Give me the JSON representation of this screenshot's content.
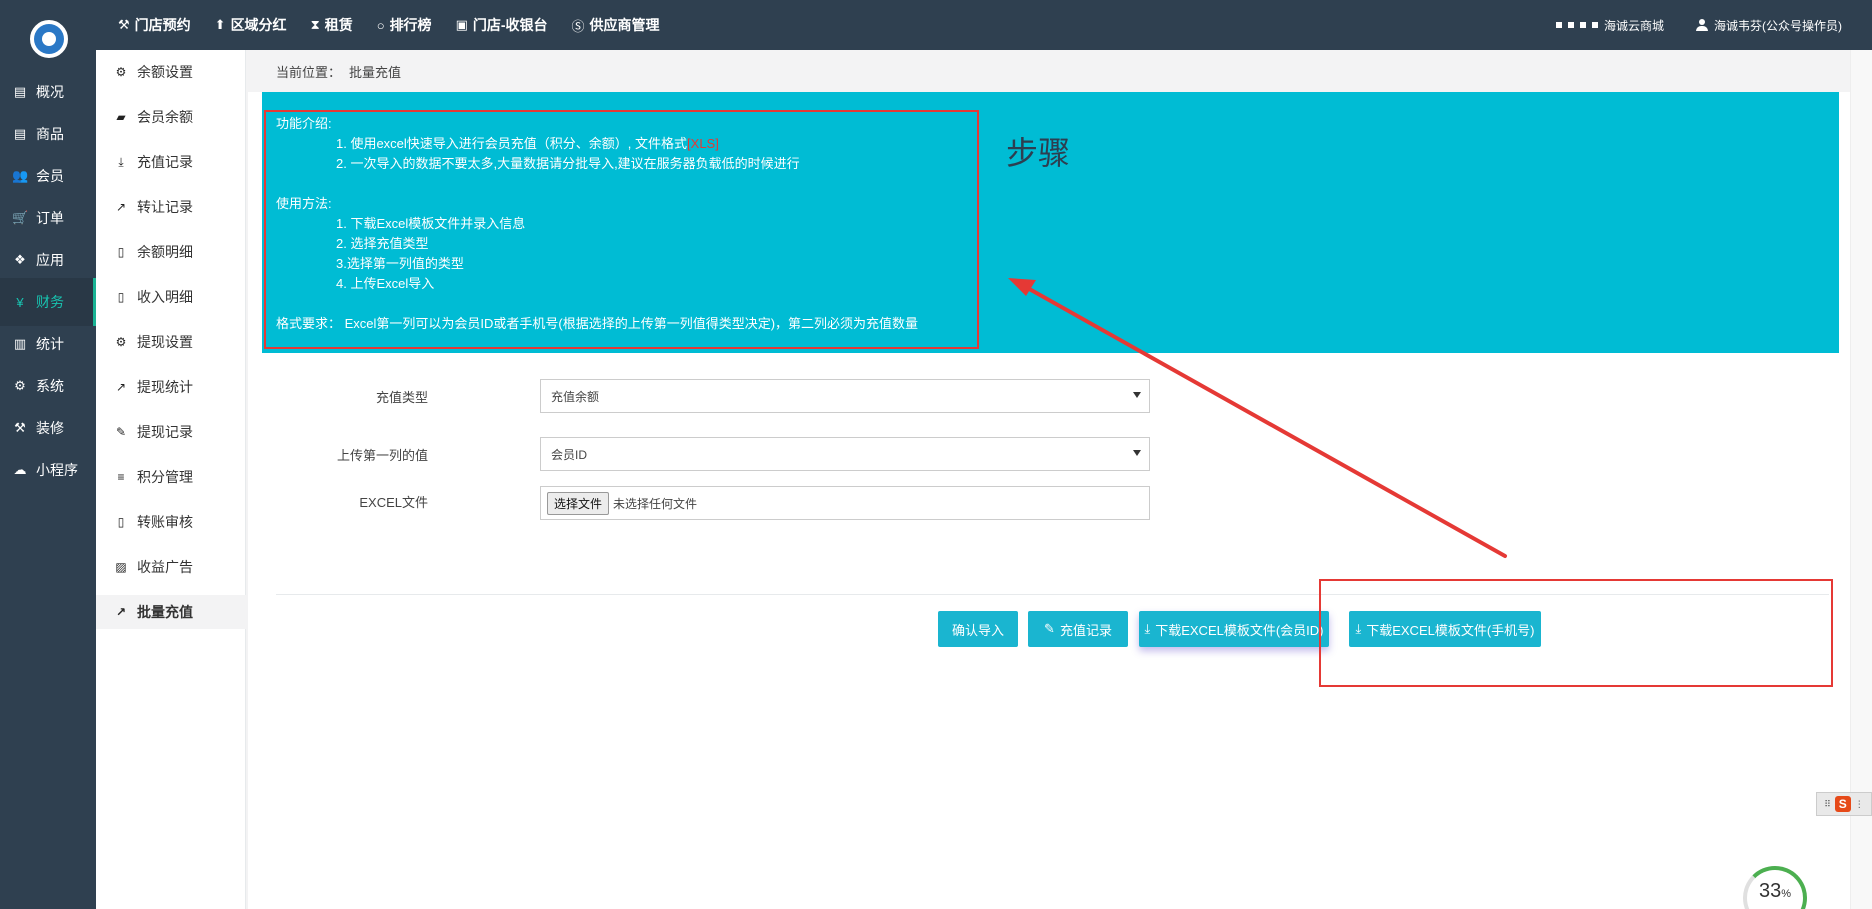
{
  "topbar": {
    "nav": [
      {
        "icon": "gavel-icon",
        "glyph": "⚒",
        "label": "门店预约"
      },
      {
        "icon": "pin-icon",
        "glyph": "⬆",
        "label": "区域分红"
      },
      {
        "icon": "hourglass-icon",
        "glyph": "⧗",
        "label": "租赁"
      },
      {
        "icon": "circle-icon",
        "glyph": "○",
        "label": "排行榜"
      },
      {
        "icon": "cash-icon",
        "glyph": "▣",
        "label": "门店-收银台"
      },
      {
        "icon": "skype-icon",
        "glyph": "Ⓢ",
        "label": "供应商管理"
      }
    ],
    "right": {
      "shop_label": "海诚云商城",
      "user_label": "海诚韦芬(公众号操作员)"
    }
  },
  "sidebar": {
    "items": [
      {
        "icon": "calendar-icon",
        "glyph": "▤",
        "label": "概况"
      },
      {
        "icon": "calendar-icon",
        "glyph": "▤",
        "label": "商品"
      },
      {
        "icon": "users-icon",
        "glyph": "👥",
        "label": "会员"
      },
      {
        "icon": "cart-icon",
        "glyph": "🛒",
        "label": "订单"
      },
      {
        "icon": "cubes-icon",
        "glyph": "❖",
        "label": "应用"
      },
      {
        "icon": "yen-icon",
        "glyph": "¥",
        "label": "财务",
        "active": true
      },
      {
        "icon": "bar-chart-icon",
        "glyph": "▥",
        "label": "统计"
      },
      {
        "icon": "gears-icon",
        "glyph": "⚙",
        "label": "系统"
      },
      {
        "icon": "gavel-icon",
        "glyph": "⚒",
        "label": "装修"
      },
      {
        "icon": "wechat-icon",
        "glyph": "☁",
        "label": "小程序"
      }
    ]
  },
  "submenu": {
    "items": [
      {
        "icon": "gear-icon",
        "glyph": "⚙",
        "label": "余额设置"
      },
      {
        "icon": "book-icon",
        "glyph": "▰",
        "label": "会员余额"
      },
      {
        "icon": "download-icon",
        "glyph": "⤓",
        "label": "充值记录"
      },
      {
        "icon": "external-link-icon",
        "glyph": "↗",
        "label": "转让记录"
      },
      {
        "icon": "file-icon",
        "glyph": "▯",
        "label": "余额明细"
      },
      {
        "icon": "file-icon",
        "glyph": "▯",
        "label": "收入明细"
      },
      {
        "icon": "gear-icon",
        "glyph": "⚙",
        "label": "提现设置"
      },
      {
        "icon": "line-chart-icon",
        "glyph": "↗",
        "label": "提现统计"
      },
      {
        "icon": "pencil-icon",
        "glyph": "✎",
        "label": "提现记录"
      },
      {
        "icon": "database-icon",
        "glyph": "≡",
        "label": "积分管理"
      },
      {
        "icon": "file-icon",
        "glyph": "▯",
        "label": "转账审核"
      },
      {
        "icon": "image-icon",
        "glyph": "▨",
        "label": "收益广告"
      },
      {
        "icon": "line-chart-icon",
        "glyph": "↗",
        "label": "批量充值",
        "active": true
      }
    ]
  },
  "breadcrumb": {
    "prefix": "当前位置：",
    "current": "批量充值"
  },
  "info": {
    "intro_title": "功能介绍:",
    "intro_1": "1. 使用excel快速导入进行会员充值（积分、余额）, 文件格式",
    "intro_1_format": "[XLS]",
    "intro_2": "2. 一次导入的数据不要太多,大量数据请分批导入,建议在服务器负载低的时候进行",
    "usage_title": "使用方法:",
    "usage_1": "1. 下载Excel模板文件并录入信息",
    "usage_2": "2. 选择充值类型",
    "usage_3": "3.选择第一列值的类型",
    "usage_4": "4. 上传Excel导入",
    "format_req": "格式要求： Excel第一列可以为会员ID或者手机号(根据选择的上传第一列值得类型决定)，第二列必须为充值数量"
  },
  "annotation": {
    "steps_label": "步骤"
  },
  "form": {
    "recharge_type_label": "充值类型",
    "recharge_type_value": "充值余额",
    "first_col_label": "上传第一列的值",
    "first_col_value": "会员ID",
    "excel_label": "EXCEL文件",
    "file_button": "选择文件",
    "file_status": "未选择任何文件"
  },
  "buttons": {
    "confirm_import": "确认导入",
    "recharge_record": "充值记录",
    "download_member_id": "下载EXCEL模板文件(会员ID)",
    "download_phone": "下载EXCEL模板文件(手机号)"
  },
  "widgets": {
    "progress_value": "33",
    "progress_unit": "%",
    "sogou_letter": "S"
  },
  "colors": {
    "sidebar_bg": "#2f4050",
    "panel_bg": "#00bcd4",
    "button_bg": "#1ab5d0",
    "annotation_red": "#e53935",
    "active_green": "#1ab394"
  }
}
